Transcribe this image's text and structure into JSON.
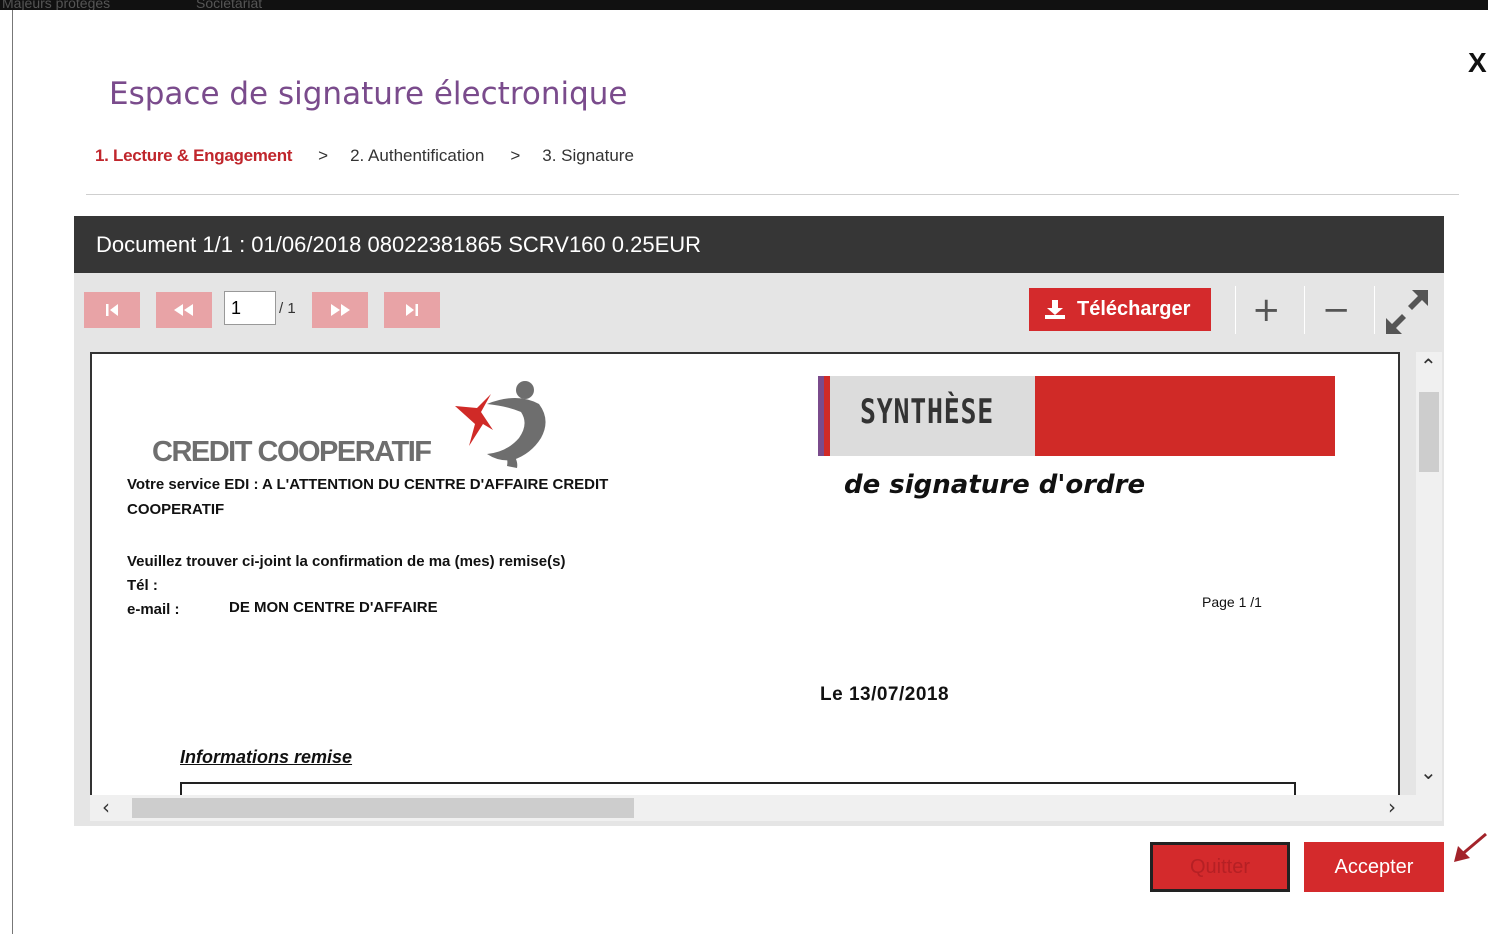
{
  "background": {
    "nav_items": [
      "Majeurs protégés",
      "Sociétariat"
    ]
  },
  "modal": {
    "title": "Espace de signature électronique",
    "close_label": "X",
    "steps": [
      {
        "label": "1. Lecture & Engagement",
        "active": true
      },
      {
        "label": "2. Authentification",
        "active": false
      },
      {
        "label": "3. Signature",
        "active": false
      }
    ],
    "step_separator": ">"
  },
  "viewer": {
    "document_title": "Document 1/1 : 01/06/2018 08022381865 SCRV160 0.25EUR",
    "toolbar": {
      "first_page_icon": "first-page-icon",
      "prev_page_icon": "rewind-icon",
      "page_input_value": "1",
      "page_total": "/ 1",
      "next_page_icon": "fast-forward-icon",
      "last_page_icon": "last-page-icon",
      "download_label": "Télécharger",
      "zoom_in": "+",
      "zoom_out": "−",
      "fullscreen_icon": "expand-icon"
    },
    "document": {
      "logo_text": "CREDIT COOPERATIF",
      "synthese_title": "SYNTHÈSE",
      "synthese_subtitle": "de signature d'ordre",
      "line_service": "Votre service EDI : A L'ATTENTION DU CENTRE D'AFFAIRE CREDIT",
      "line_service_cont": "COOPERATIF",
      "line_confirm": "Veuillez trouver ci-joint la confirmation de ma (mes) remise(s)",
      "tel_label": "Tél :",
      "email_label": "e-mail :",
      "email_value": "DE MON CENTRE D'AFFAIRE",
      "page_label": "Page 1 /1",
      "date": "Le 13/07/2018",
      "section_title": "Informations remise"
    }
  },
  "actions": {
    "quit_label": "Quitter",
    "accept_label": "Accepter"
  },
  "colors": {
    "brand_red": "#d42a2c",
    "title_purple": "#7a4b8c",
    "header_dark": "#363636",
    "nav_button_pink": "#e8a3a6"
  }
}
